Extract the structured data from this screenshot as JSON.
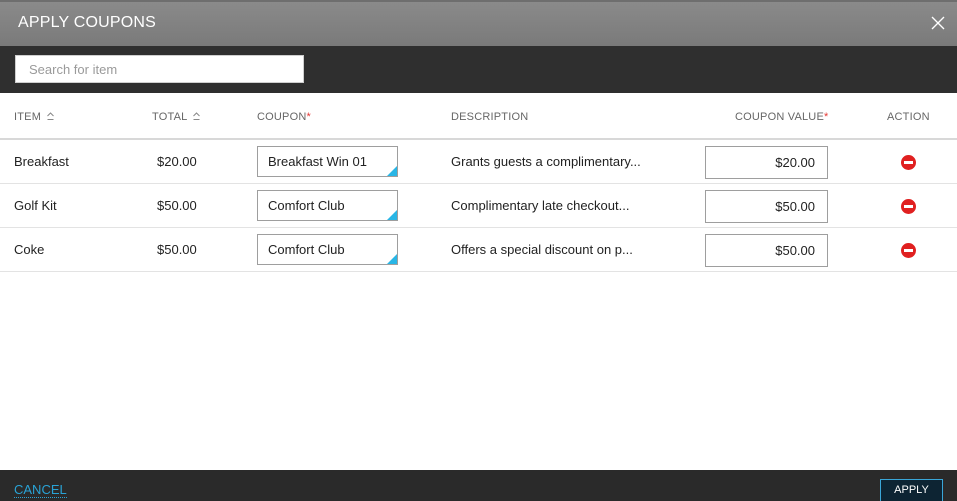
{
  "dialog": {
    "title": "APPLY COUPONS",
    "close_icon": "close-icon"
  },
  "search": {
    "placeholder": "Search for item",
    "value": ""
  },
  "table": {
    "headers": {
      "item": "ITEM",
      "total": "TOTAL",
      "coupon": "COUPON",
      "coupon_required": "*",
      "description": "DESCRIPTION",
      "coupon_value": "COUPON VALUE",
      "coupon_value_required": "*",
      "action": "ACTION"
    },
    "rows": [
      {
        "item": "Breakfast",
        "total": "$20.00",
        "coupon": "Breakfast Win 01",
        "description": "Grants guests a complimentary...",
        "coupon_value": "$20.00",
        "action_icon": "remove-icon"
      },
      {
        "item": "Golf Kit",
        "total": "$50.00",
        "coupon": "Comfort Club",
        "description": "Complimentary late checkout...",
        "coupon_value": "$50.00",
        "action_icon": "remove-icon"
      },
      {
        "item": "Coke",
        "total": "$50.00",
        "coupon": "Comfort Club",
        "description": "Offers a special discount on p...",
        "coupon_value": "$50.00",
        "action_icon": "remove-icon"
      }
    ]
  },
  "footer": {
    "cancel_label": "CANCEL",
    "apply_label": "APPLY"
  },
  "colors": {
    "title_bar": "#808080",
    "search_bar": "#2f2f2f",
    "footer": "#2a2a2a",
    "accent": "#29a3d6",
    "required": "#e53935",
    "remove": "#e02020"
  }
}
